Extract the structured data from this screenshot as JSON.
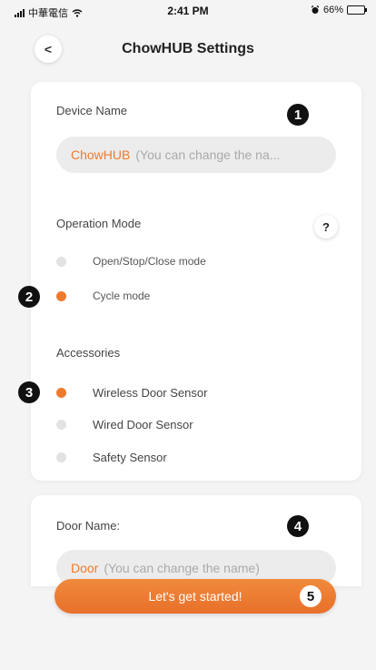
{
  "status_bar": {
    "carrier": "中華電信",
    "time": "2:41 PM",
    "battery": "66%"
  },
  "header": {
    "back_glyph": "<",
    "title": "ChowHUB Settings"
  },
  "device": {
    "label": "Device Name",
    "value": "ChowHUB",
    "hint": "(You can change the na..."
  },
  "operation_mode": {
    "label": "Operation Mode",
    "help_glyph": "?",
    "options": [
      {
        "label": "Open/Stop/Close mode",
        "selected": false
      },
      {
        "label": "Cycle mode",
        "selected": true
      }
    ]
  },
  "accessories": {
    "label": "Accessories",
    "options": [
      {
        "label": "Wireless Door Sensor",
        "selected": true
      },
      {
        "label": "Wired Door Sensor",
        "selected": false
      },
      {
        "label": "Safety Sensor",
        "selected": false
      }
    ]
  },
  "door": {
    "label": "Door Name:",
    "value": "Door",
    "hint": "(You can change the name)"
  },
  "cta": {
    "label": "Let's get started!"
  },
  "badges": [
    "1",
    "2",
    "3",
    "4",
    "5"
  ],
  "colors": {
    "accent": "#ee7a2e",
    "background": "#f4f4f4"
  }
}
